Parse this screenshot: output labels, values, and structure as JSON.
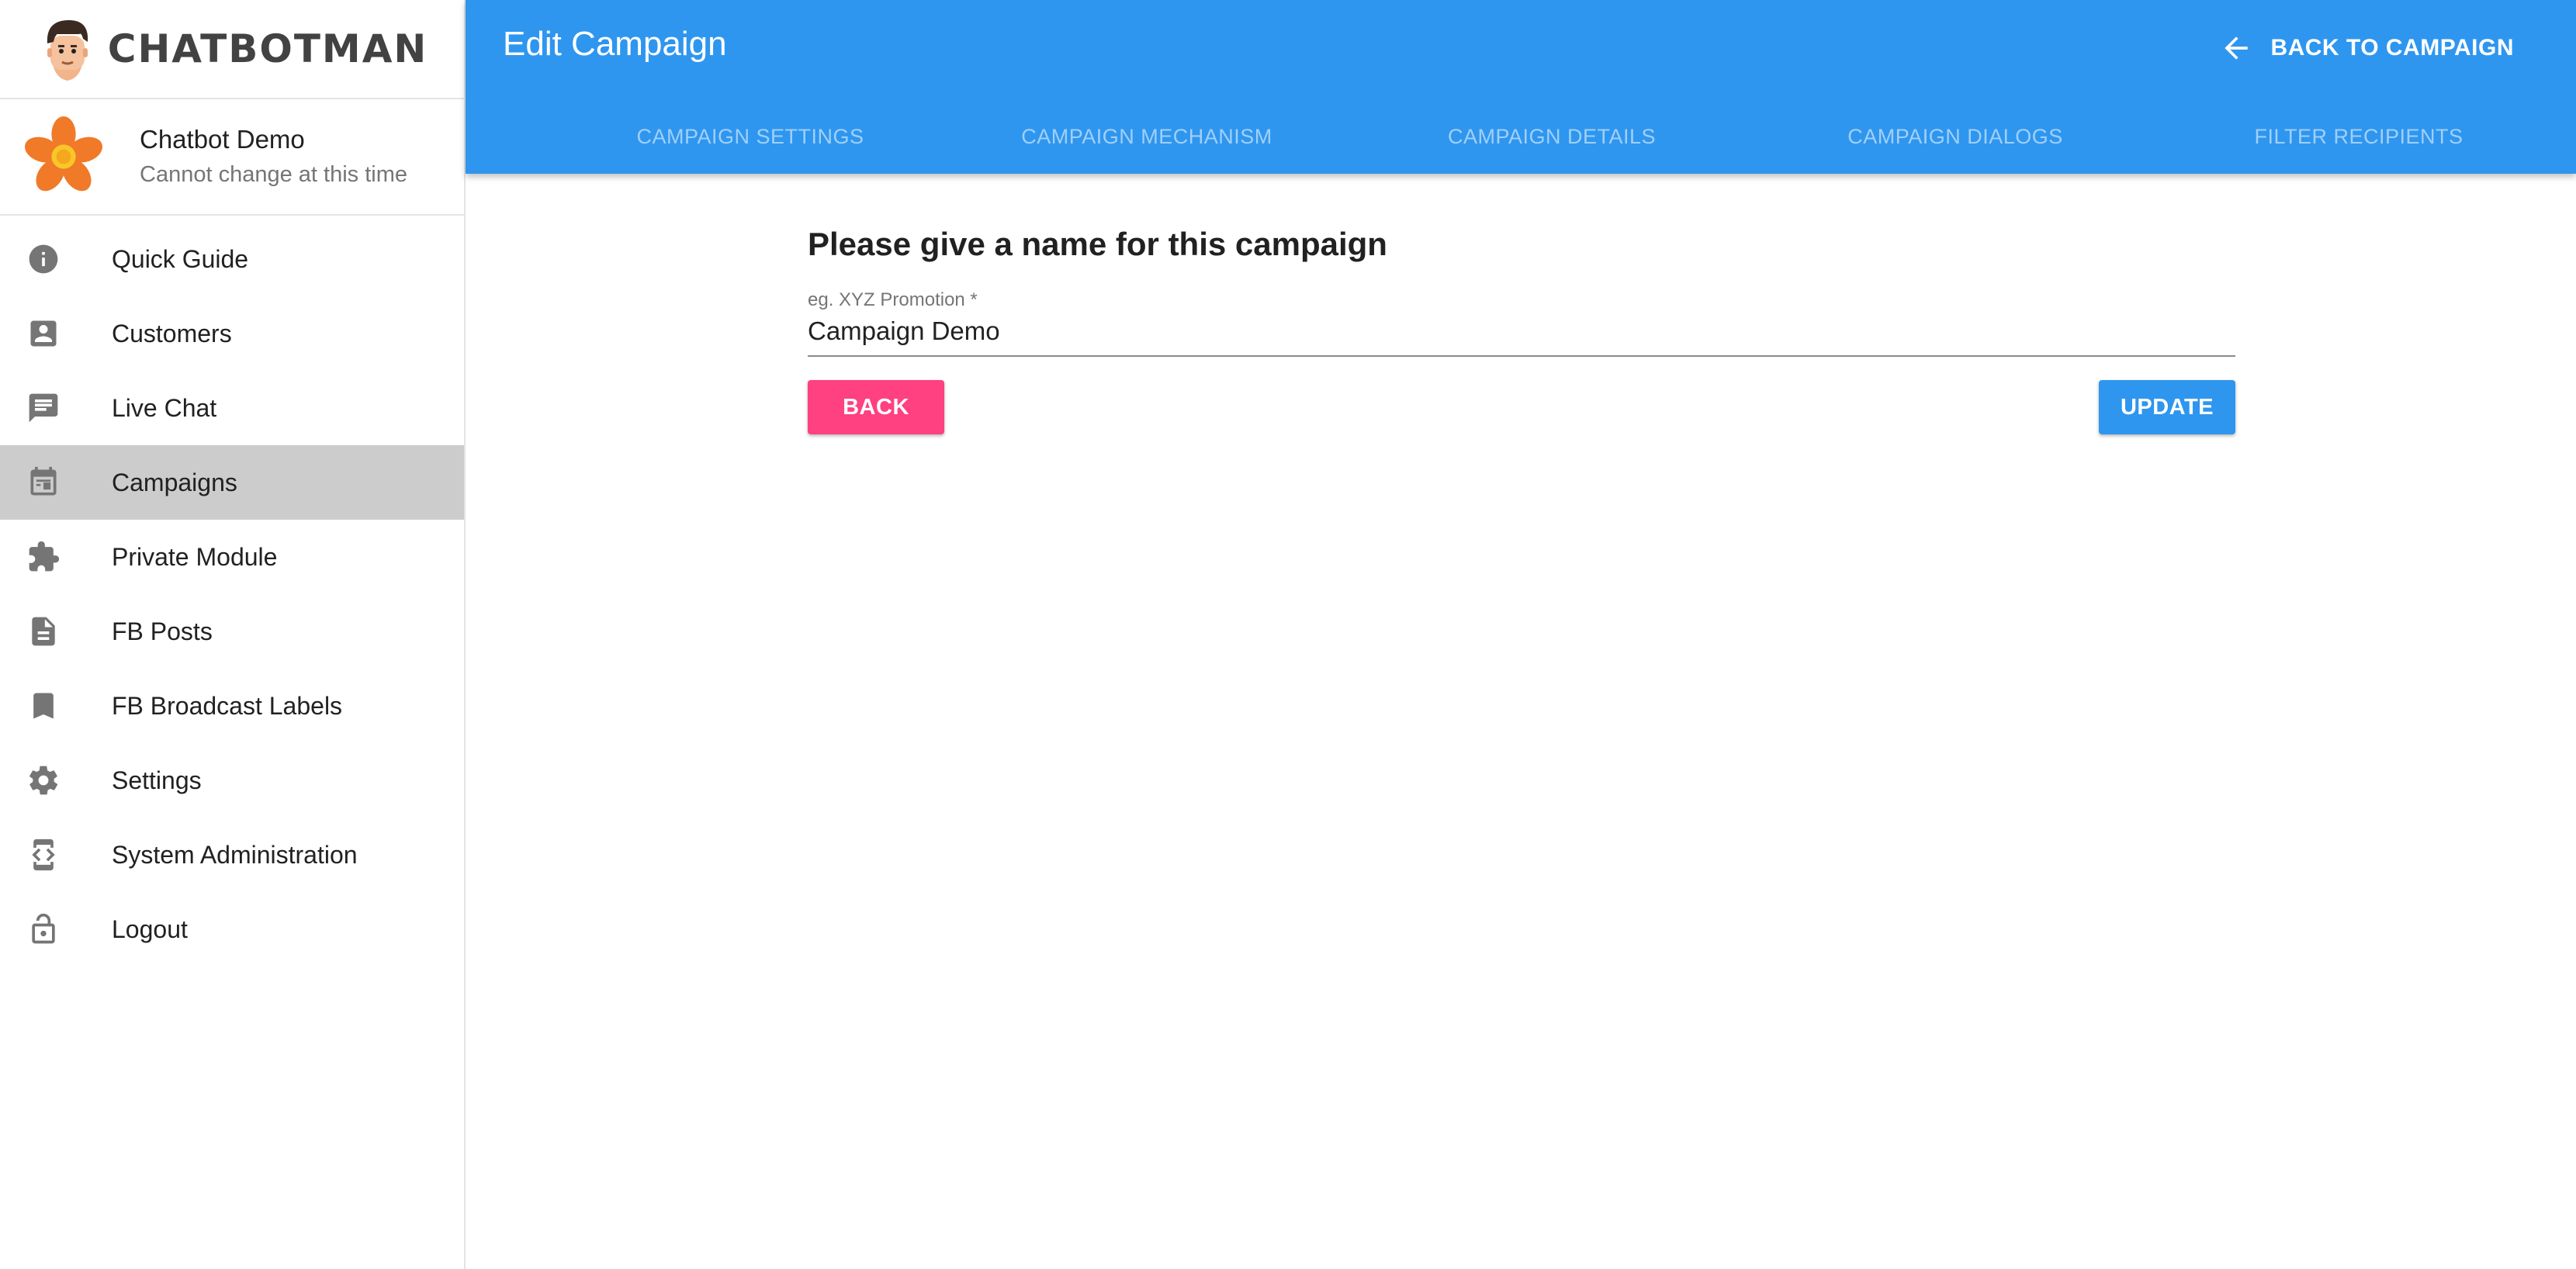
{
  "brand": {
    "name": "CHATBOTMAN"
  },
  "bot": {
    "name": "Chatbot Demo",
    "subtitle": "Cannot change at this time"
  },
  "sidebar": {
    "items": [
      {
        "label": "Quick Guide",
        "icon": "info-icon",
        "active": false
      },
      {
        "label": "Customers",
        "icon": "account-box-icon",
        "active": false
      },
      {
        "label": "Live Chat",
        "icon": "chat-icon",
        "active": false
      },
      {
        "label": "Campaigns",
        "icon": "calendar-icon",
        "active": true
      },
      {
        "label": "Private Module",
        "icon": "puzzle-icon",
        "active": false
      },
      {
        "label": "FB Posts",
        "icon": "document-icon",
        "active": false
      },
      {
        "label": "FB Broadcast Labels",
        "icon": "bookmark-icon",
        "active": false
      },
      {
        "label": "Settings",
        "icon": "gear-icon",
        "active": false
      },
      {
        "label": "System Administration",
        "icon": "developer-mode-icon",
        "active": false
      },
      {
        "label": "Logout",
        "icon": "lock-open-icon",
        "active": false
      }
    ]
  },
  "header": {
    "title": "Edit Campaign",
    "back_label": "BACK TO CAMPAIGN",
    "tabs": [
      "CAMPAIGN SETTINGS",
      "CAMPAIGN MECHANISM",
      "CAMPAIGN DETAILS",
      "CAMPAIGN DIALOGS",
      "FILTER RECIPIENTS"
    ]
  },
  "main": {
    "heading": "Please give a name for this campaign",
    "name_field": {
      "label": "eg. XYZ Promotion *",
      "value": "Campaign Demo"
    },
    "back_button": "BACK",
    "update_button": "UPDATE"
  },
  "colors": {
    "primary": "#2e96ef",
    "accent": "#ff4081",
    "active_nav": "#cccccc"
  }
}
